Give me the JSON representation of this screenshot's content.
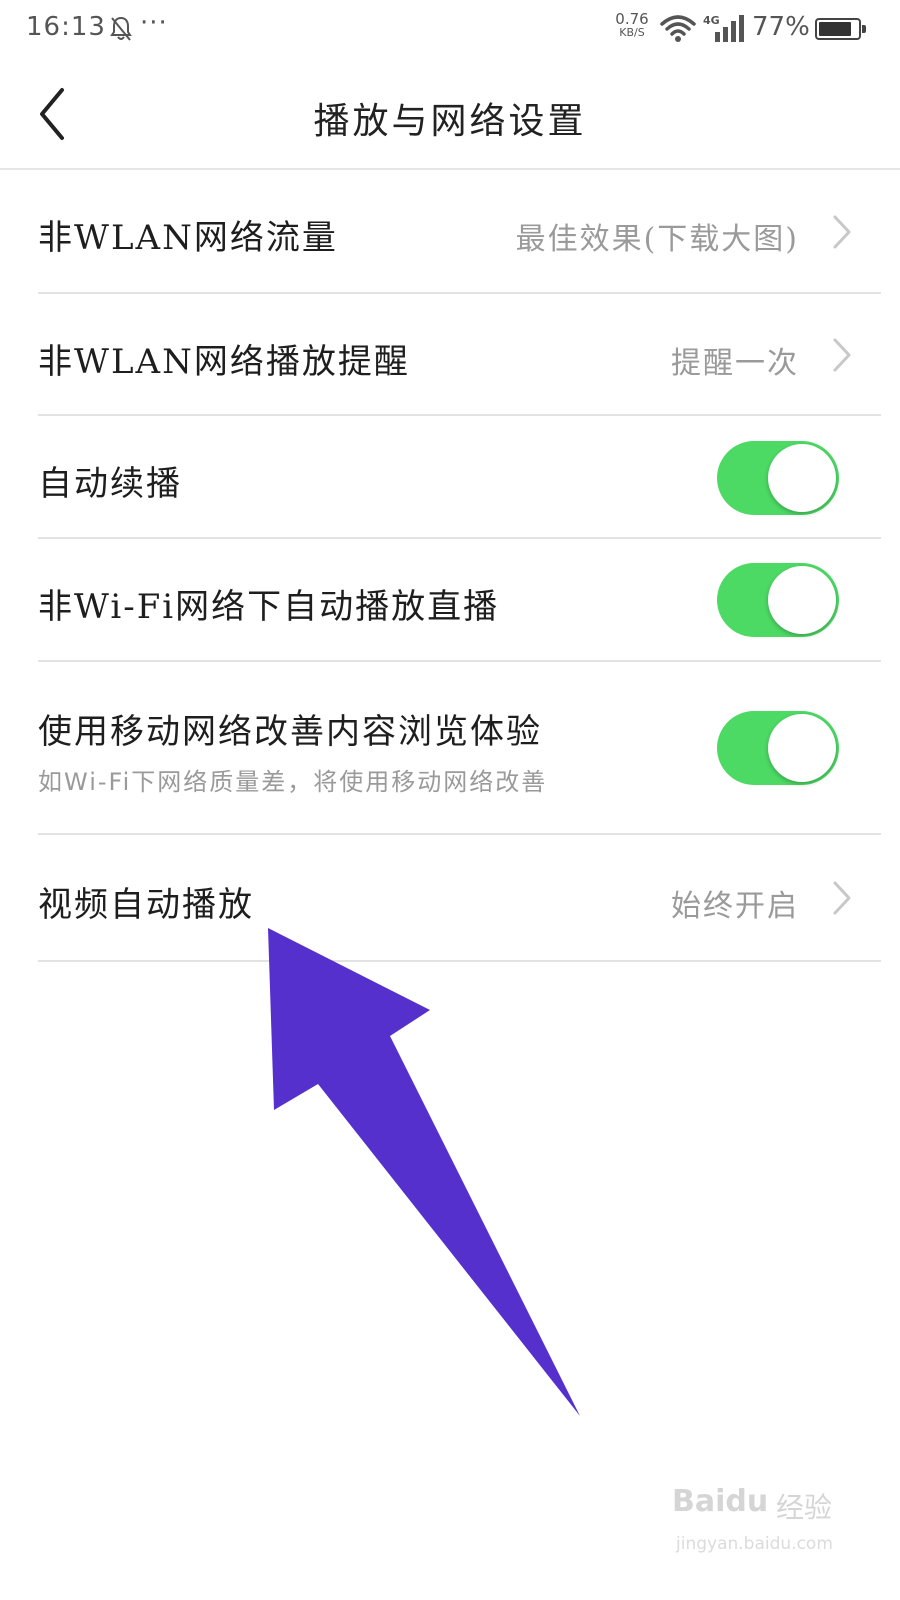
{
  "status_bar": {
    "time": "16:13",
    "dots": "···",
    "net_speed_value": "0.76",
    "net_speed_unit": "KB/S",
    "network_type": "4G",
    "battery_percent": "77%"
  },
  "header": {
    "title": "播放与网络设置"
  },
  "settings": [
    {
      "label": "非WLAN网络流量",
      "value": "最佳效果(下载大图)"
    },
    {
      "label": "非WLAN网络播放提醒",
      "value": "提醒一次"
    },
    {
      "label": "自动续播",
      "toggle_on": true
    },
    {
      "label": "非Wi-Fi网络下自动播放直播",
      "toggle_on": true
    },
    {
      "label": "使用移动网络改善内容浏览体验",
      "sublabel": "如Wi-Fi下网络质量差，将使用移动网络改善",
      "toggle_on": true
    },
    {
      "label": "视频自动播放",
      "value": "始终开启"
    }
  ],
  "watermark": {
    "brand": "Baidu",
    "brand_cn": "经验",
    "url": "jingyan.baidu.com"
  },
  "colors": {
    "toggle_on": "#4cd964",
    "arrow": "#5530cc",
    "divider": "#e2e2e2"
  }
}
